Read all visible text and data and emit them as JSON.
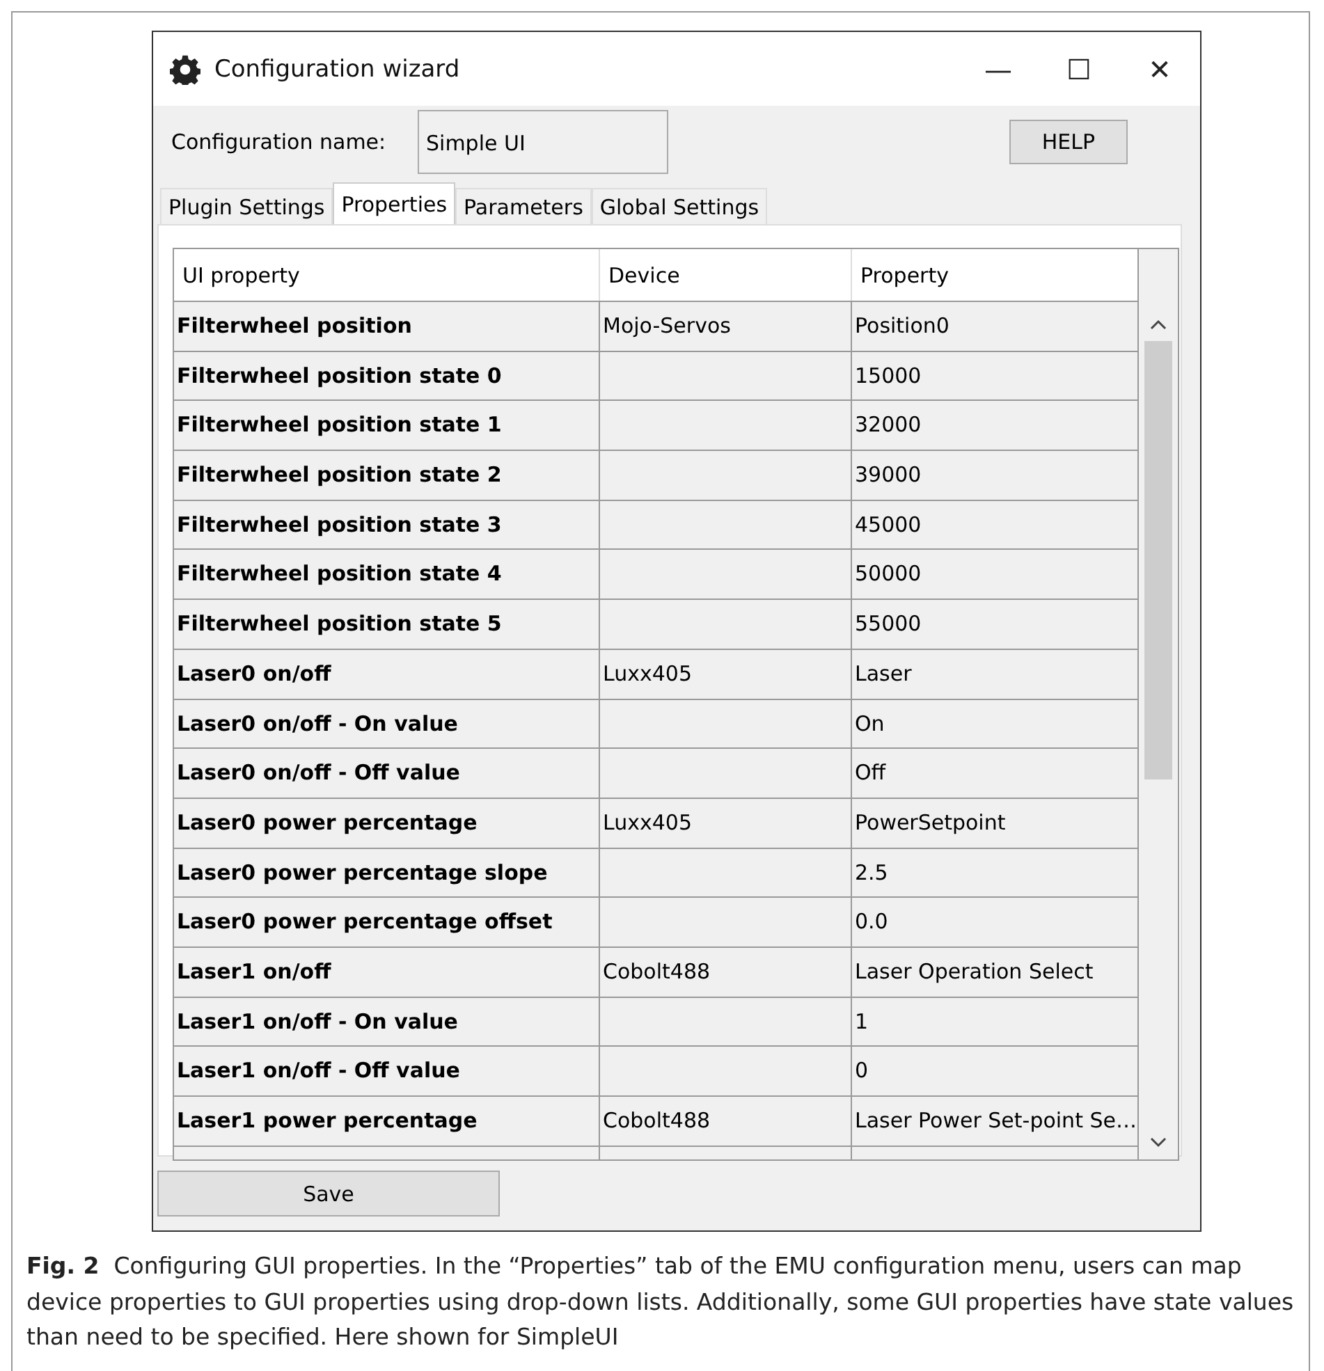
{
  "window": {
    "title": "Configuration wizard",
    "controls": [
      "—",
      "☐",
      "✕"
    ]
  },
  "config": {
    "label": "Configuration name:",
    "value": "Simple UI",
    "help_button": "HELP"
  },
  "tabs": [
    {
      "label": "Plugin Settings",
      "selected": false
    },
    {
      "label": "Properties",
      "selected": true
    },
    {
      "label": "Parameters",
      "selected": false
    },
    {
      "label": "Global Settings",
      "selected": false
    }
  ],
  "table": {
    "columns": [
      "UI property",
      "Device",
      "Property"
    ],
    "rows": [
      {
        "ui_property": "Filterwheel position",
        "device": "Mojo-Servos",
        "property": "Position0"
      },
      {
        "ui_property": "Filterwheel position state 0",
        "property": "15000"
      },
      {
        "ui_property": "Filterwheel position state 1",
        "property": "32000"
      },
      {
        "ui_property": "Filterwheel position state 2",
        "property": "39000"
      },
      {
        "ui_property": "Filterwheel position state 3",
        "property": "45000"
      },
      {
        "ui_property": "Filterwheel position state 4",
        "property": "50000"
      },
      {
        "ui_property": "Filterwheel position state 5",
        "property": "55000"
      },
      {
        "ui_property": "Laser0 on/off",
        "device": "Luxx405",
        "property": "Laser"
      },
      {
        "ui_property": "Laser0 on/off - On value",
        "property": "On"
      },
      {
        "ui_property": "Laser0 on/off - Off value",
        "property": "Off"
      },
      {
        "ui_property": "Laser0 power percentage",
        "device": "Luxx405",
        "property": "PowerSetpoint"
      },
      {
        "ui_property": "Laser0 power percentage slope",
        "property": "2.5"
      },
      {
        "ui_property": "Laser0 power percentage offset",
        "property": "0.0"
      },
      {
        "ui_property": "Laser1 on/off",
        "device": "Cobolt488",
        "property": "Laser Operation Select"
      },
      {
        "ui_property": "Laser1 on/off - On value",
        "property": "1"
      },
      {
        "ui_property": "Laser1 on/off - Off value",
        "property": "0"
      },
      {
        "ui_property": "Laser1 power percentage",
        "device": "Cobolt488",
        "property": "Laser Power Set-point Se…"
      }
    ]
  },
  "save_button": "Save",
  "caption": {
    "label": "Fig. 2",
    "text": "Configuring GUI properties. In the “Properties” tab of the EMU configuration menu, users can map device properties to GUI properties using drop-down lists. Additionally, some GUI properties have state values than need to be specified. Here shown for SimpleUI"
  }
}
